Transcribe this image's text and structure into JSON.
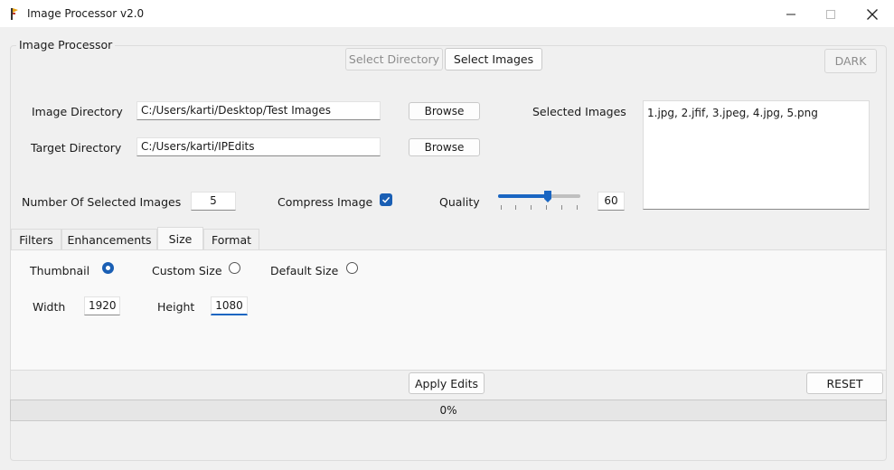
{
  "window": {
    "title": "Image Processor v2.0"
  },
  "group_title": "Image Processor",
  "mode_buttons": {
    "select_directory": "Select Directory",
    "select_images": "Select Images"
  },
  "theme_button": "DARK",
  "image_directory": {
    "label": "Image Directory",
    "value": "C:/Users/karti/Desktop/Test Images",
    "browse": "Browse"
  },
  "target_directory": {
    "label": "Target Directory",
    "value": "C:/Users/karti/IPEdits",
    "browse": "Browse"
  },
  "selected_images": {
    "label": "Selected Images",
    "list": "1.jpg, 2.jfif, 3.jpeg, 4.jpg, 5.png"
  },
  "count": {
    "label": "Number Of Selected Images",
    "value": "5"
  },
  "compress": {
    "label": "Compress Image",
    "checked": true
  },
  "quality": {
    "label": "Quality",
    "value": "60",
    "fraction": 0.6
  },
  "tabs": [
    "Filters",
    "Enhancements",
    "Size",
    "Format"
  ],
  "active_tab": "Size",
  "size_options": {
    "thumbnail": "Thumbnail",
    "custom": "Custom Size",
    "default": "Default Size",
    "selected": "Thumbnail"
  },
  "dimensions": {
    "width_label": "Width",
    "width_value": "1920",
    "height_label": "Height",
    "height_value": "1080"
  },
  "actions": {
    "apply": "Apply Edits",
    "reset": "RESET"
  },
  "progress": {
    "text": "0%",
    "value": 0
  },
  "colors": {
    "accent": "#1a5fb4",
    "background": "#f0f0f0"
  }
}
